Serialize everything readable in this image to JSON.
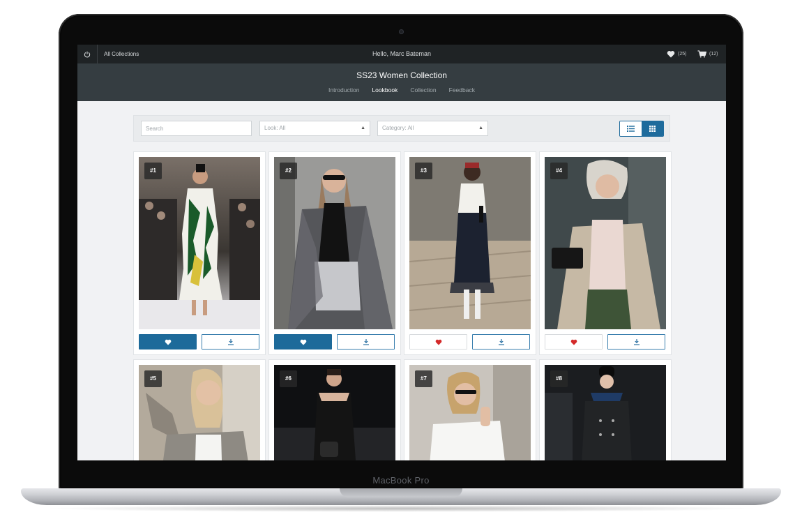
{
  "device": {
    "label": "MacBook Pro"
  },
  "topbar": {
    "nav_link": "All Collections",
    "greeting": "Hello, Marc Bateman",
    "favorites_count": "(25)",
    "cart_count": "(12)"
  },
  "collection": {
    "title": "SS23 Women Collection",
    "tabs": [
      {
        "label": "Introduction",
        "active": false
      },
      {
        "label": "Lookbook",
        "active": true
      },
      {
        "label": "Collection",
        "active": false
      },
      {
        "label": "Feedback",
        "active": false
      }
    ]
  },
  "filters": {
    "search_placeholder": "Search",
    "look": "Look: All",
    "category": "Category: All",
    "view_mode": "grid"
  },
  "looks": [
    {
      "label": "#1",
      "favorited": true
    },
    {
      "label": "#2",
      "favorited": true
    },
    {
      "label": "#3",
      "favorited": false
    },
    {
      "label": "#4",
      "favorited": false
    },
    {
      "label": "#5",
      "favorited": false
    },
    {
      "label": "#6",
      "favorited": false
    },
    {
      "label": "#7",
      "favorited": false
    },
    {
      "label": "#8",
      "favorited": false
    }
  ],
  "colors": {
    "accent": "#1d6a9a",
    "heart_inactive": "#d42a2a",
    "topbar": "#1f2325",
    "header": "#353d41"
  }
}
